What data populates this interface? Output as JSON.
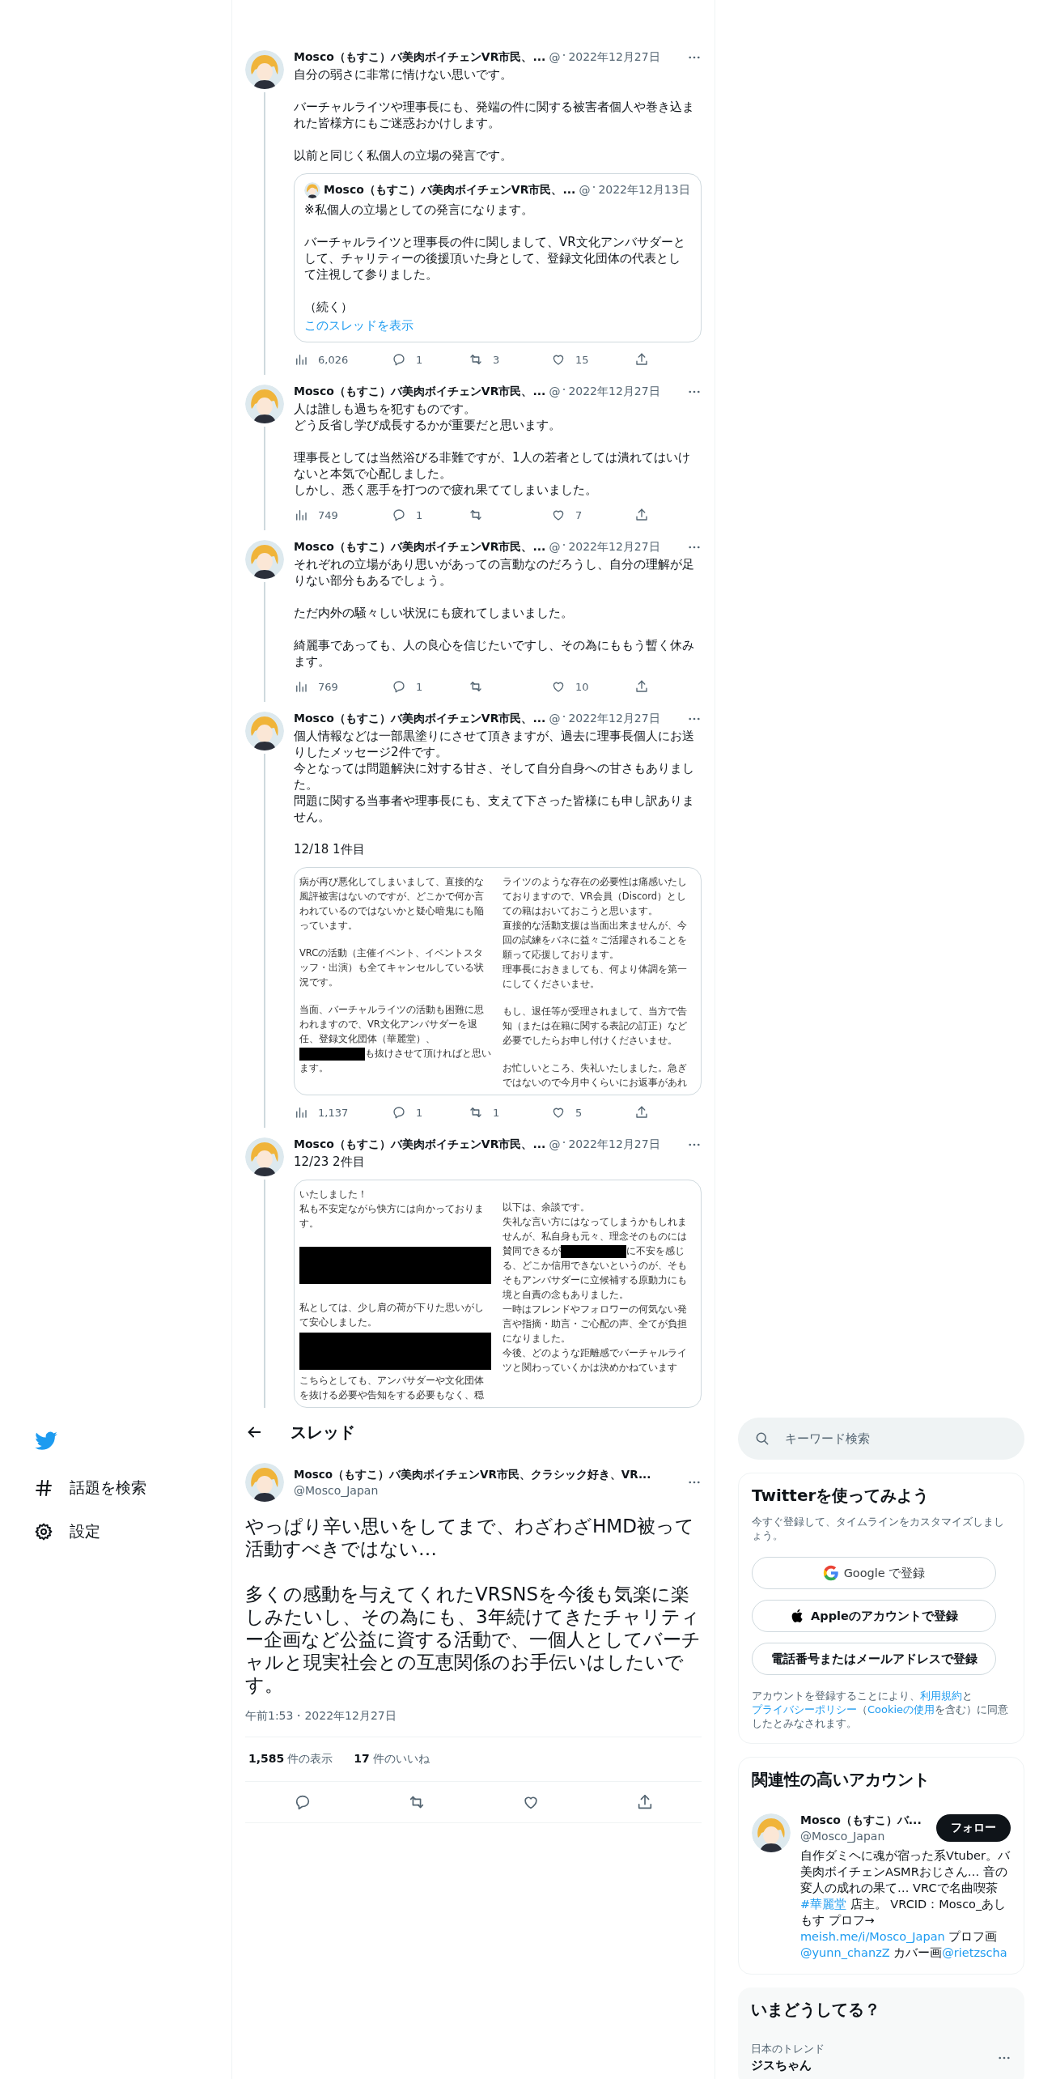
{
  "thread": [
    {
      "name": "Mosco（もすこ）バ美肉ボイチェンVR市民、...",
      "handle": "@",
      "date": "2022年12月27日",
      "paragraphs": [
        [
          "自分の弱さに非常に情けない思いです。"
        ],
        [
          "バーチャルライツや理事長にも、発端の件に関する被害者個人や巻き込まれた皆様方にもご迷惑おかけします。"
        ],
        [
          "以前と同じく私個人の立場の発言です。"
        ]
      ],
      "quote": {
        "name": "Mosco（もすこ）バ美肉ボイチェンVR市民、...",
        "handle": "@",
        "date": "2022年12月13日",
        "paragraphs": [
          [
            "※私個人の立場としての発言になります。"
          ],
          [
            "バーチャルライツと理事長の件に関しまして、VR文化アンバサダーとして、チャリティーの後援頂いた身として、登録文化団体の代表として注視して参りました。"
          ],
          [
            "（続く）"
          ]
        ],
        "link": "このスレッドを表示"
      },
      "stats": {
        "views": "6,026",
        "replies": "1",
        "retweets": "3",
        "likes": "15"
      }
    },
    {
      "name": "Mosco（もすこ）バ美肉ボイチェンVR市民、...",
      "handle": "@",
      "date": "2022年12月27日",
      "paragraphs": [
        [
          "人は誰しも過ちを犯すものです。",
          "どう反省し学び成長するかが重要だと思います。"
        ],
        [
          "理事長としては当然浴びる非難ですが、1人の若者としては潰れてはいけないと本気で心配しました。",
          "しかし、悉く悪手を打つので疲れ果ててしまいました。"
        ]
      ],
      "stats": {
        "views": "749",
        "replies": "1",
        "likes": "7"
      }
    },
    {
      "name": "Mosco（もすこ）バ美肉ボイチェンVR市民、...",
      "handle": "@",
      "date": "2022年12月27日",
      "paragraphs": [
        [
          "それぞれの立場があり思いがあっての言動なのだろうし、自分の理解が足りない部分もあるでしょう。"
        ],
        [
          "ただ内外の騒々しい状況にも疲れてしまいました。"
        ],
        [
          "綺麗事であっても、人の良心を信じたいですし、その為にももう暫く休みます。"
        ]
      ],
      "stats": {
        "views": "769",
        "replies": "1",
        "likes": "10"
      }
    },
    {
      "name": "Mosco（もすこ）バ美肉ボイチェンVR市民、...",
      "handle": "@",
      "date": "2022年12月27日",
      "paragraphs": [
        [
          "個人情報などは一部黒塗りにさせて頂きますが、過去に理事長個人にお送りしたメッセージ2件です。",
          "今となっては問題解決に対する甘さ、そして自分自身への甘さもありました。",
          "問題に関する当事者や理事長にも、支えて下さった皆様にも申し訳ありません。"
        ],
        [
          "12/18 1件目"
        ]
      ],
      "image": {
        "columns": [
          [
            {
              "kind": "text",
              "text": "病が再び悪化してしまいまして、直接的な風評被害はないのですが、どこかで何か言われているのではないかと疑心暗鬼にも陥っています。"
            },
            {
              "kind": "blank"
            },
            {
              "kind": "text",
              "text": "VRCの活動（主催イベント、イベントスタッフ・出演）も全てキャンセルしている状況です。"
            },
            {
              "kind": "blank"
            },
            {
              "kind": "mixed",
              "parts": [
                {
                  "kind": "text",
                  "text": "当面、バーチャルライツの活動も困難に思われますので、VR文化アンバサダーを退任、登録文化団体（華麗堂）、"
                },
                {
                  "kind": "redaction"
                },
                {
                  "kind": "text",
                  "text": "も抜けさせて頂ければと思います。"
                }
              ]
            }
          ],
          [
            {
              "kind": "text",
              "text": "ライツのような存在の必要性は痛感いたしておりますので、VR会員（Discord）としての籍はおいておこうと思います。"
            },
            {
              "kind": "text",
              "text": "直接的な活動支援は当面出来ませんが、今回の試練をバネに益々ご活躍されることを願って応援しております。"
            },
            {
              "kind": "text",
              "text": "理事長におきましても、何より体調を第一にしてくださいませ。"
            },
            {
              "kind": "blank"
            },
            {
              "kind": "text",
              "text": "もし、退任等が受理されまして、当方で告知（または在籍に関する表記の訂正）など必要でしたらお申し付けくださいませ。"
            },
            {
              "kind": "blank"
            },
            {
              "kind": "text",
              "text": "お忙しいところ、失礼いたしました。急ぎではないので今月中くらいにお返事があれ"
            }
          ]
        ]
      },
      "stats": {
        "views": "1,137",
        "replies": "1",
        "retweets": "1",
        "likes": "5"
      }
    },
    {
      "name": "Mosco（もすこ）バ美肉ボイチェンVR市民、...",
      "handle": "@",
      "date": "2022年12月27日",
      "paragraphs": [
        [
          "12/23 2件目"
        ]
      ],
      "image": {
        "columns": [
          [
            {
              "kind": "text",
              "text": "いたしました！"
            },
            {
              "kind": "text",
              "text": "私も不安定ながら快方には向かっております。"
            },
            {
              "kind": "blank"
            },
            {
              "kind": "redaction"
            },
            {
              "kind": "blank"
            },
            {
              "kind": "text",
              "text": "私としては、少し肩の荷が下りた思いがして安心しました。"
            },
            {
              "kind": "redaction"
            },
            {
              "kind": "text",
              "text": "こちらとしても、アンバサダーや文化団体を抜ける必要や告知をする必要もなく、穏"
            }
          ],
          [
            {
              "kind": "blank"
            },
            {
              "kind": "text",
              "text": "以下は、余談です。"
            },
            {
              "kind": "mixed",
              "parts": [
                {
                  "kind": "text",
                  "text": "失礼な言い方にはなってしまうかもしれませんが、私自身も元々、理念そのものには賛同できるが"
                },
                {
                  "kind": "redaction"
                },
                {
                  "kind": "text",
                  "text": "に不安を感じる、どこか信用できないというのが、そもそもアンバサダーに立候補する原動力にも"
                }
              ]
            },
            {
              "kind": "text",
              "text": "境と自責の念もありました。"
            },
            {
              "kind": "text",
              "text": "一時はフレンドやフォロワーの何気ない発言や指摘・助言・ご心配の声、全てが負担になりました。"
            },
            {
              "kind": "text",
              "text": "今後、どのような距離感でバーチャルライツと関わっていくかは決めかねています"
            }
          ]
        ]
      }
    }
  ],
  "nav": {
    "items": [
      {
        "kind": "hashtag",
        "label": "話題を検索"
      },
      {
        "kind": "gear",
        "label": "設定"
      }
    ]
  },
  "header": {
    "title": "スレッド"
  },
  "main_tweet": {
    "name": "Mosco（もすこ）バ美肉ボイチェンVR市民、クラシック好き、VR...",
    "handle": "@Mosco_Japan",
    "paragraphs": [
      [
        "やっぱり辛い思いをしてまで、わざわざHMD被って活動すべきではない…"
      ],
      [
        "多くの感動を与えてくれたVRSNSを今後も気楽に楽しみたいし、その為にも、3年続けてきたチャリティー企画など公益に資する活動で、一個人としてバーチャルと現実社会との互恵関係のお手伝いはしたいです。"
      ]
    ],
    "time": "午前1:53・2022年12月27日",
    "views_count": "1,585",
    "views_label": "件の表示",
    "likes_count": "17",
    "likes_label": "件のいいね"
  },
  "search": {
    "placeholder": "キーワード検索"
  },
  "signup": {
    "title": "Twitterを使ってみよう",
    "subtitle": "今すぐ登録して、タイムラインをカスタマイズしましょう。",
    "buttons": [
      {
        "kind": "google",
        "label": "Google で登録"
      },
      {
        "kind": "apple",
        "label": "Appleのアカウントで登録"
      },
      {
        "kind": "plain",
        "label": "電話番号またはメールアドレスで登録"
      }
    ],
    "terms": [
      {
        "text": "アカウントを登録することにより、",
        "link": false
      },
      {
        "text": "利用規約",
        "link": true
      },
      {
        "text": "と",
        "link": false
      },
      {
        "text": "プライバシーポリシー",
        "link": true
      },
      {
        "text": "（",
        "link": false
      },
      {
        "text": "Cookieの使用",
        "link": true
      },
      {
        "text": "を含む）に同意したとみなされます。",
        "link": false
      }
    ]
  },
  "related": {
    "title": "関連性の高いアカウント",
    "name": "Mosco（もすこ）バ...",
    "handle": "@Mosco_Japan",
    "button": "フォロー",
    "bio": [
      {
        "text": "自作ダミヘに魂が宿った系Vtuber。バ美肉ボイチェンASMRおじさん… 音の変人の成れの果て… VRCで名曲喫茶 ",
        "link": false
      },
      {
        "text": "#華麗堂",
        "link": true
      },
      {
        "text": " 店主。 VRCID：Mosco_あしもす プロフ→",
        "link": false
      },
      {
        "text": "meish.me/i/Mosco_Japan",
        "link": true
      },
      {
        "text": " プロフ画",
        "link": false
      },
      {
        "text": "@yunn_chanzZ",
        "link": true
      },
      {
        "text": " カバー画",
        "link": false
      },
      {
        "text": "@rietzscha",
        "link": true
      }
    ]
  },
  "trends": {
    "title": "いまどうしてる？",
    "items": [
      {
        "context": "日本のトレンド",
        "name": "ジスちゃん"
      }
    ]
  }
}
